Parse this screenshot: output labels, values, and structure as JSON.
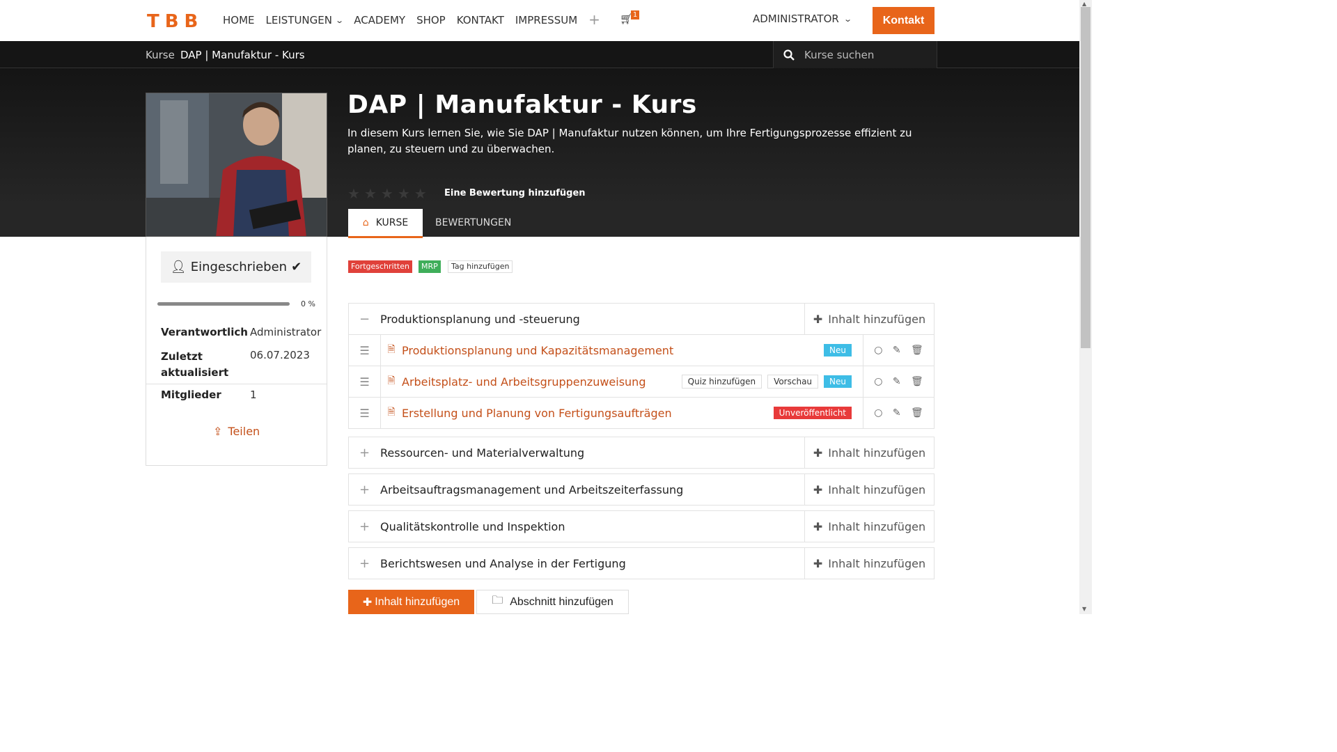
{
  "nav": {
    "logo": "TBB",
    "items": [
      {
        "label": "HOME"
      },
      {
        "label": "LEISTUNGEN",
        "has_dropdown": true
      },
      {
        "label": "ACADEMY"
      },
      {
        "label": "SHOP"
      },
      {
        "label": "KONTAKT"
      },
      {
        "label": "IMPRESSUM"
      }
    ],
    "plus": "+",
    "cart_count": "1",
    "user": "ADMINISTRATOR",
    "cta": "Kontakt"
  },
  "breadcrumb": {
    "parent": "Kurse",
    "current": "DAP | Manufaktur - Kurs"
  },
  "search": {
    "placeholder": "Kurse suchen"
  },
  "course": {
    "title": "DAP | Manufaktur - Kurs",
    "description": "In diesem Kurs lernen Sie, wie Sie DAP | Manufaktur nutzen können, um Ihre Fertigungsprozesse effizient zu planen, zu steuern und zu überwachen.",
    "add_rating": "Eine Bewertung hinzufügen",
    "rating": 0
  },
  "tabs": {
    "kurse": "KURSE",
    "bewertungen": "BEWERTUNGEN"
  },
  "sidebar": {
    "enrolled": "Eingeschrieben",
    "progress_label": "0 %",
    "progress": 0,
    "responsible_key": "Verantwortlich",
    "responsible_val": "Administrator",
    "updated_key": "Zuletzt aktualisiert",
    "updated_val": "06.07.2023",
    "members_key": "Mitglieder",
    "members_val": "1",
    "share": "Teilen"
  },
  "tags": {
    "t1": "Fortgeschritten",
    "t2": "MRP",
    "add": "Tag hinzufügen"
  },
  "add_content": "Inhalt hinzufügen",
  "sections": [
    {
      "title": "Produktionsplanung und -steuerung",
      "expanded": true
    },
    {
      "title": "Ressourcen- und Materialverwaltung"
    },
    {
      "title": "Arbeitsauftragsmanagement und Arbeitszeiterfassung"
    },
    {
      "title": "Qualitätskontrolle und Inspektion"
    },
    {
      "title": "Berichtswesen und Analyse in der Fertigung"
    }
  ],
  "lessons": [
    {
      "title": "Produktionsplanung und Kapazitätsmanagement",
      "badge": "Neu"
    },
    {
      "title": "Arbeitsplatz- und Arbeitsgruppenzuweisung",
      "quiz": "Quiz hinzufügen",
      "preview": "Vorschau",
      "badge": "Neu"
    },
    {
      "title": "Erstellung und Planung von Fertigungsaufträgen",
      "badge": "Unveröffentlicht"
    }
  ],
  "bottom": {
    "add_content": "Inhalt hinzufügen",
    "add_section": "Abschnitt hinzufügen"
  },
  "colors": {
    "accent": "#e8651a",
    "neu": "#3ebde6",
    "unpublished": "#e83a3a",
    "mrp": "#3fae5a",
    "advanced": "#e0413a"
  }
}
